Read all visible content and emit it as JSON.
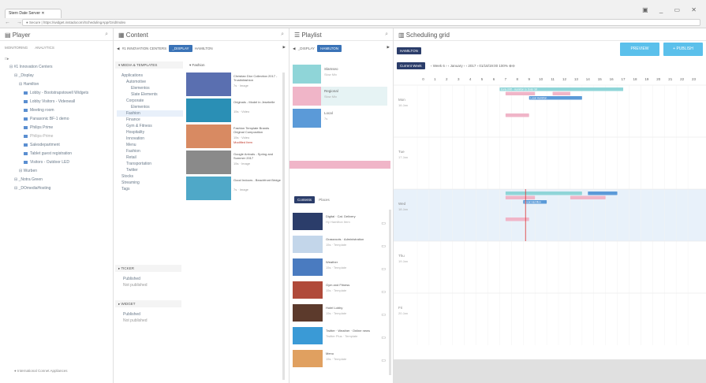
{
  "browser": {
    "tab_title": "Stern Date Server",
    "url": "● Secure | https://widget.instadocom/SchedulingApp/Grid/Index",
    "controls": "▣ _ ▭ ✕"
  },
  "player": {
    "title": "Player",
    "tabs": [
      "MONITORING",
      "ANALYTICS"
    ],
    "tree": [
      {
        "label": "#1 Innovation Centers",
        "indent": 1
      },
      {
        "label": "_Display",
        "indent": 2
      },
      {
        "label": "Hamilton",
        "indent": 3
      },
      {
        "label": "Lobby - Bootstrapstowell Widgets",
        "indent": 4
      },
      {
        "label": "Lobby Visitors - Videowall",
        "indent": 4
      },
      {
        "label": "Meeting room",
        "indent": 4
      },
      {
        "label": "Panasonic BF-1 demo",
        "indent": 4
      },
      {
        "label": "Philips Prime",
        "indent": 4
      },
      {
        "label": "Philips-Prime",
        "indent": 4
      },
      {
        "label": "Salesdepartment",
        "indent": 4
      },
      {
        "label": "Tablet guest registration",
        "indent": 4
      },
      {
        "label": "Visitors - Outdoor LED",
        "indent": 4
      },
      {
        "label": "Wurben",
        "indent": 3
      },
      {
        "label": "_Notra Green",
        "indent": 2
      },
      {
        "label": "_DOmediaHosting",
        "indent": 2
      }
    ],
    "footer": "● International Connet Appliances"
  },
  "content": {
    "title": "Content",
    "crumbs": [
      "#1 INNOVATION CENTERS",
      "_DISPLAY",
      "HAMILTON"
    ],
    "media_header": "MEDIA & TEMPLATES",
    "folder_header": "Fashion",
    "tree": [
      {
        "label": "Applications",
        "indent": 1
      },
      {
        "label": "Automotive",
        "indent": 2
      },
      {
        "label": "Elementos",
        "indent": 3
      },
      {
        "label": "Slate Elements",
        "indent": 3
      },
      {
        "label": "Corporate",
        "indent": 2
      },
      {
        "label": "Elementos",
        "indent": 3
      },
      {
        "label": "Fashion",
        "indent": 2,
        "selected": true
      },
      {
        "label": "Finance",
        "indent": 2
      },
      {
        "label": "Gym & Fitness",
        "indent": 2
      },
      {
        "label": "Hospitality",
        "indent": 2
      },
      {
        "label": "Innovation",
        "indent": 2
      },
      {
        "label": "Menu",
        "indent": 2
      },
      {
        "label": "Fashion",
        "indent": 2
      },
      {
        "label": "Retail",
        "indent": 2
      },
      {
        "label": "Transportation",
        "indent": 2
      },
      {
        "label": "Twitter",
        "indent": 2
      },
      {
        "label": "Stocks",
        "indent": 1
      },
      {
        "label": "Streaming",
        "indent": 1
      },
      {
        "label": "Tags",
        "indent": 1
      }
    ],
    "items": [
      {
        "title": "Christian Dior Collection 2017 - Trustinfashion",
        "meta": "7s · Image",
        "color": "#5a6fb0"
      },
      {
        "title": "Originals - Model in Jesebelle",
        "meta": "15s · Video",
        "color": "#2a8fb5"
      },
      {
        "title": "Fashion Template Brands Original Composition",
        "meta": "15s · Video",
        "color": "#d88a62",
        "flag": "Modified Item"
      },
      {
        "title": "Google Arrivals - Spring and Summer 2017",
        "meta": "15s · Image",
        "color": "#8a8a8a"
      },
      {
        "title": "Good Indoors - Beachfront Bridge",
        "meta": "7s · Image",
        "color": "#4fa8c8"
      }
    ],
    "ticker": {
      "title": "TICKER",
      "items": [
        "Published",
        "Not published"
      ]
    },
    "widget": {
      "title": "WIDGET",
      "items": [
        "Published",
        "Not published"
      ]
    }
  },
  "playlist": {
    "title": "Playlist",
    "crumbs": [
      "_DISPLAY",
      "HAMILTON"
    ],
    "slots": [
      {
        "title": "Slamseo",
        "meta": "Slow Mix",
        "color": "#8fd5d8"
      },
      {
        "title": "Regional",
        "meta": "Slow Mix",
        "color": "#f0b5c8"
      },
      {
        "title": "Local",
        "meta": "7s",
        "color": "#5b9ad8"
      }
    ],
    "tabs": [
      "Contents",
      "Places"
    ],
    "items": [
      {
        "title": "Digital · Cat. Delivery",
        "meta": "Hy Hamilton Item",
        "color": "#2b3d6a"
      },
      {
        "title": "Grassroots · Administration",
        "meta": "15s · Template",
        "color": "#c3d6ea"
      },
      {
        "title": "Weather",
        "meta": "15s · Template",
        "color": "#4a7bc0"
      },
      {
        "title": "Gym and Fitness",
        "meta": "15s · Template",
        "color": "#b04a3a"
      },
      {
        "title": "Hotel Lobby",
        "meta": "15s · Template",
        "color": "#5c3a2c"
      },
      {
        "title": "Twitter · Weather · Online news",
        "meta": "Twitter Plus · Template",
        "color": "#3a9ad6"
      },
      {
        "title": "Menu",
        "meta": "15s · Template",
        "color": "#e0a060"
      }
    ]
  },
  "grid": {
    "title": "Scheduling grid",
    "crumb": "HAMILTON",
    "preview": "PREVIEW",
    "publish": "+ PUBLISH",
    "current_week": "Current Week",
    "toolbar": "‹ Week 6 ›   ‹ January ›   ‹ 2017 ›   01/18/19:00   100% ⊕⊖",
    "hours": [
      "0",
      "1",
      "2",
      "3",
      "4",
      "5",
      "6",
      "7",
      "8",
      "9",
      "10",
      "11",
      "12",
      "13",
      "14",
      "15",
      "16",
      "17",
      "18",
      "19",
      "20",
      "21",
      "22",
      "23"
    ],
    "days": [
      {
        "label": "Mon",
        "date": "16 Jan"
      },
      {
        "label": "Tue",
        "date": "17 Jan"
      },
      {
        "label": "Wed",
        "date": "18 Jan"
      },
      {
        "label": "Thu",
        "date": "19 Jan"
      },
      {
        "label": "Fri",
        "date": "20 Jan"
      }
    ],
    "events": [
      {
        "row": 0,
        "start": 7,
        "end": 17.5,
        "lane": 0,
        "color": "#8fd5d8",
        "label": "Early shift - Hamilton to Dolor Sit"
      },
      {
        "row": 0,
        "start": 7.5,
        "end": 10,
        "lane": 1,
        "color": "#f0b5c8",
        "label": ""
      },
      {
        "row": 0,
        "start": 11.5,
        "end": 13,
        "lane": 1,
        "color": "#f0b5c8",
        "label": ""
      },
      {
        "row": 0,
        "start": 9.5,
        "end": 14,
        "lane": 2,
        "color": "#5b9ad8",
        "label": "Local Hamilton"
      },
      {
        "row": 0,
        "start": 7.5,
        "end": 9.5,
        "lane": 6,
        "color": "#f0b5c8",
        "label": ""
      },
      {
        "row": 2,
        "start": 7.5,
        "end": 14,
        "lane": 0,
        "color": "#8fd5d8",
        "label": ""
      },
      {
        "row": 2,
        "start": 14.5,
        "end": 17,
        "lane": 0,
        "color": "#5b9ad8",
        "label": ""
      },
      {
        "row": 2,
        "start": 7.5,
        "end": 10,
        "lane": 1,
        "color": "#f0b5c8",
        "label": ""
      },
      {
        "row": 2,
        "start": 13,
        "end": 16,
        "lane": 1,
        "color": "#f0b5c8",
        "label": ""
      },
      {
        "row": 2,
        "start": 9,
        "end": 11,
        "lane": 2,
        "color": "#5b9ad8",
        "label": "Local Hamilton"
      },
      {
        "row": 2,
        "start": 7.5,
        "end": 9.5,
        "lane": 6,
        "color": "#f0b5c8",
        "label": ""
      }
    ],
    "now_hour": 9.2,
    "now_row": 2
  }
}
